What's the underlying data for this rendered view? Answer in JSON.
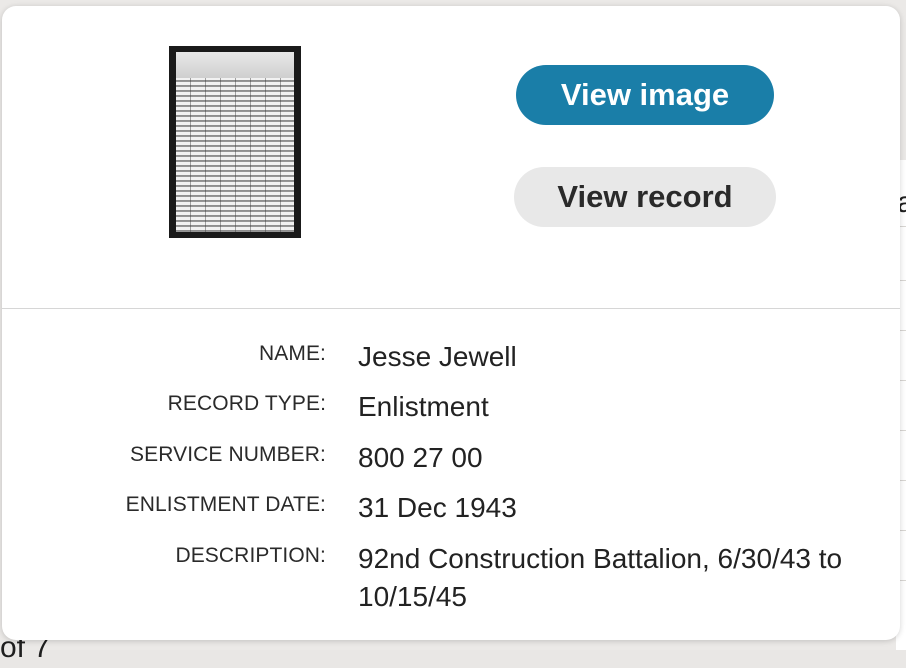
{
  "card": {
    "thumbnail_alt": "Record image thumbnail",
    "view_image_label": "View image",
    "view_record_label": "View record"
  },
  "fields": [
    {
      "label": "NAME:",
      "value": "Jesse Jewell"
    },
    {
      "label": "RECORD TYPE:",
      "value": "Enlistment"
    },
    {
      "label": "SERVICE NUMBER:",
      "value": "800 27 00"
    },
    {
      "label": "ENLISTMENT DATE:",
      "value": "31 Dec 1943"
    },
    {
      "label": "DESCRIPTION:",
      "value": "92nd Construction Battalion, 6/30/43 to 10/15/45"
    }
  ],
  "underlay": {
    "right_glyph": "a",
    "bottom_text": "of 7"
  },
  "colors": {
    "primary_button": "#1a7ea8",
    "secondary_button": "#e8e8e8"
  }
}
